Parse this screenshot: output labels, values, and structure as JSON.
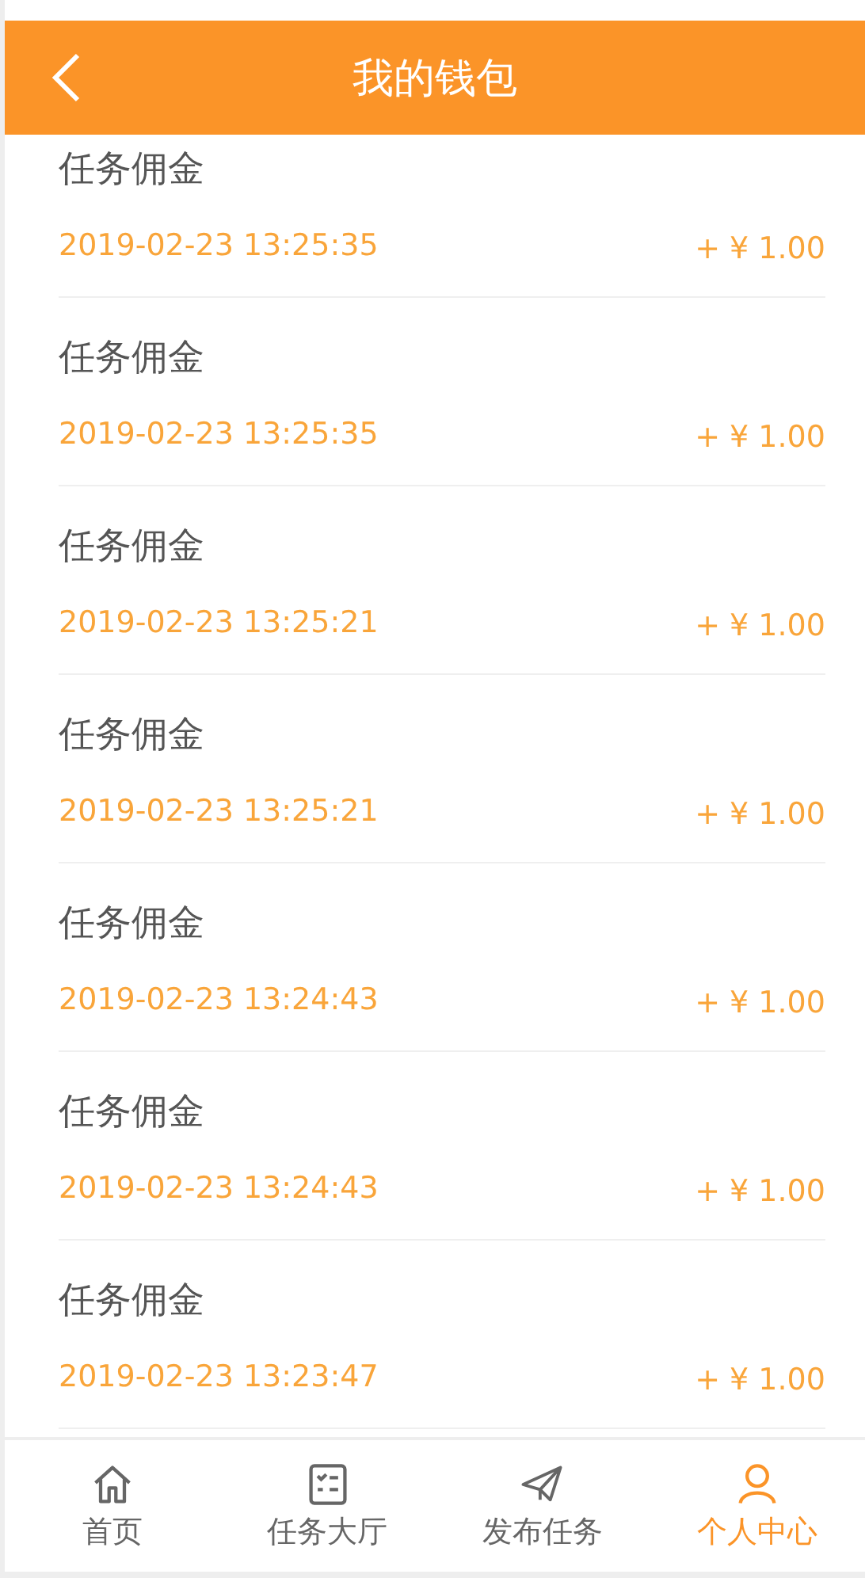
{
  "header": {
    "title": "我的钱包"
  },
  "records": [
    {
      "title": "任务佣金",
      "time": "2019-02-23 13:25:35",
      "amount": "+ ¥ 1.00"
    },
    {
      "title": "任务佣金",
      "time": "2019-02-23 13:25:35",
      "amount": "+ ¥ 1.00"
    },
    {
      "title": "任务佣金",
      "time": "2019-02-23 13:25:21",
      "amount": "+ ¥ 1.00"
    },
    {
      "title": "任务佣金",
      "time": "2019-02-23 13:25:21",
      "amount": "+ ¥ 1.00"
    },
    {
      "title": "任务佣金",
      "time": "2019-02-23 13:24:43",
      "amount": "+ ¥ 1.00"
    },
    {
      "title": "任务佣金",
      "time": "2019-02-23 13:24:43",
      "amount": "+ ¥ 1.00"
    },
    {
      "title": "任务佣金",
      "time": "2019-02-23 13:23:47",
      "amount": "+ ¥ 1.00"
    }
  ],
  "tab_bar": [
    {
      "kind": "home",
      "label": "首页",
      "selected": false
    },
    {
      "kind": "tasks",
      "label": "任务大厅",
      "selected": false
    },
    {
      "kind": "publish",
      "label": "发布任务",
      "selected": false
    },
    {
      "kind": "profile",
      "label": "个人中心",
      "selected": true
    }
  ]
}
